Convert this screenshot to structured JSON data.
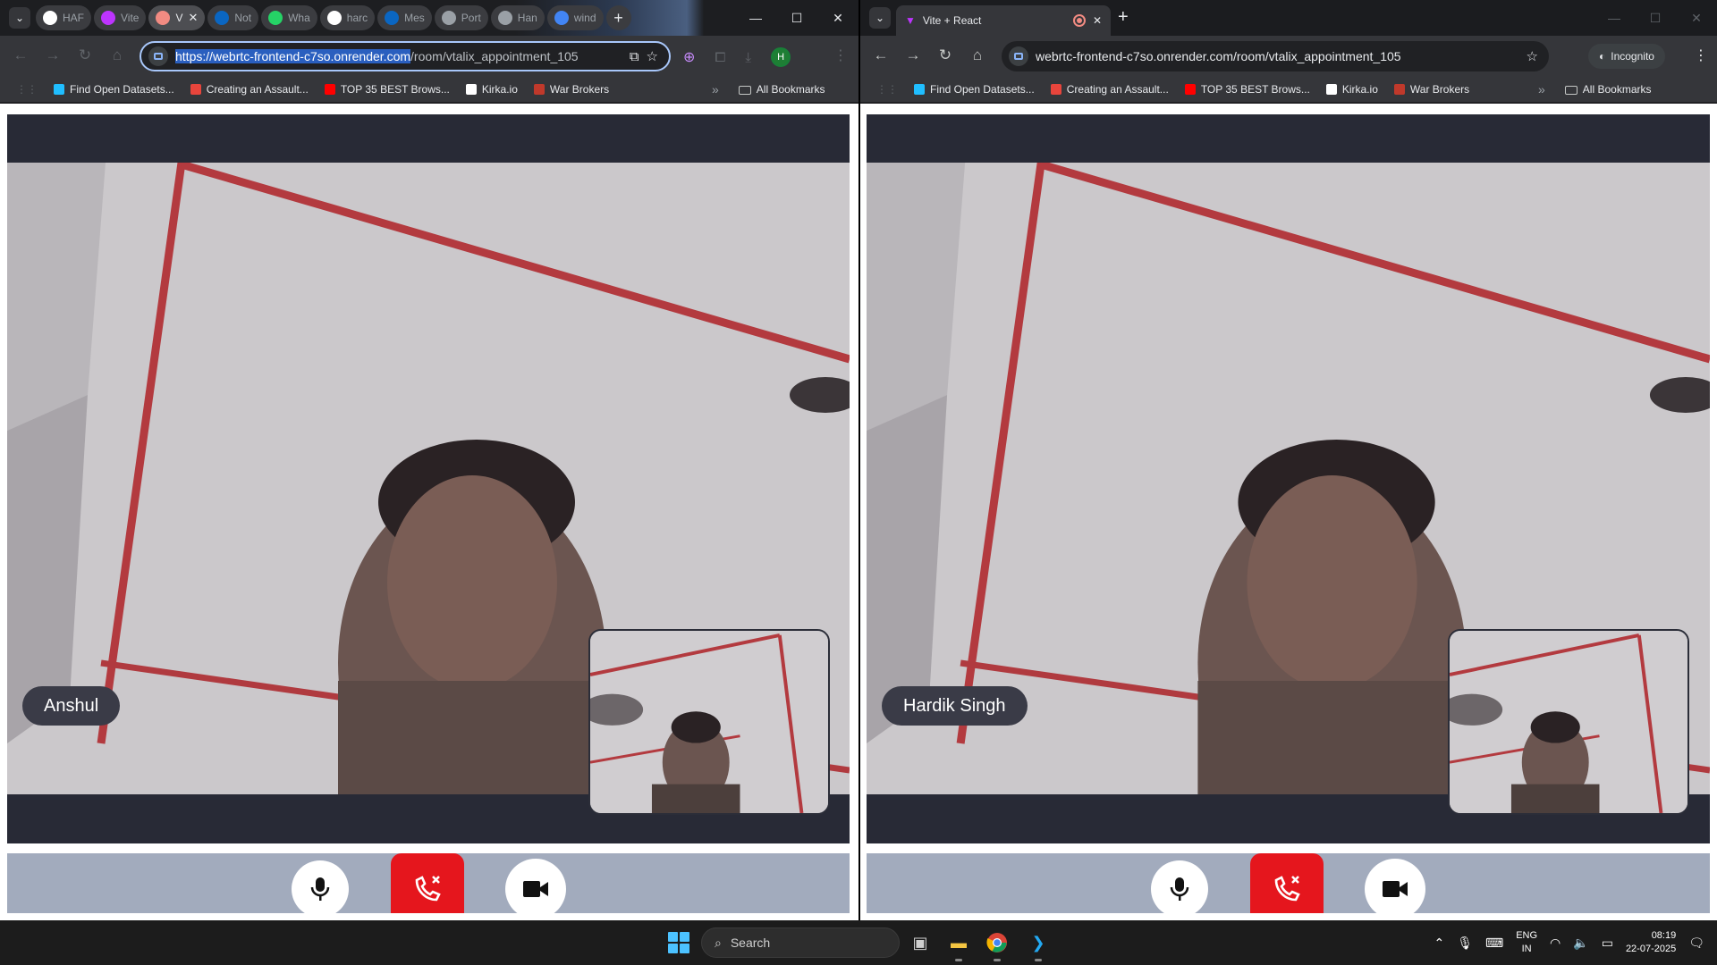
{
  "left_window": {
    "tabs": [
      {
        "label": "HAF",
        "icon": "chatgpt-icon",
        "color": "#ffffff"
      },
      {
        "label": "Vite",
        "icon": "vite-icon",
        "color": "#bd34fe"
      },
      {
        "label": "V",
        "icon": "recording-icon",
        "color": "#f28b82",
        "active": true
      },
      {
        "label": "Not",
        "icon": "linkedin-icon",
        "color": "#0a66c2"
      },
      {
        "label": "Wha",
        "icon": "whatsapp-icon",
        "color": "#25d366"
      },
      {
        "label": "harc",
        "icon": "github-icon",
        "color": "#ffffff"
      },
      {
        "label": "Mes",
        "icon": "linkedin-icon",
        "color": "#0a66c2"
      },
      {
        "label": "Port",
        "icon": "globe-icon",
        "color": "#9aa0a6"
      },
      {
        "label": "Han",
        "icon": "globe-icon",
        "color": "#9aa0a6"
      },
      {
        "label": "wind",
        "icon": "google-icon",
        "color": "#4285f4"
      }
    ],
    "url_selected": "https://webrtc-frontend-c7so.onrender.com",
    "url_rest": "/room/vtalix_appointment_105",
    "profile_initial": "H",
    "participant_name": "Anshul"
  },
  "right_window": {
    "tab_title": "Vite + React",
    "url": "webrtc-frontend-c7so.onrender.com/room/vtalix_appointment_105",
    "incognito_label": "Incognito",
    "participant_name": "Hardik Singh"
  },
  "bookmarks": [
    {
      "label": "Find Open Datasets...",
      "icon": "kaggle-icon",
      "color": "#20beff"
    },
    {
      "label": "Creating an Assault...",
      "icon": "recording-icon",
      "color": "#e8453c"
    },
    {
      "label": "TOP 35 BEST Brows...",
      "icon": "youtube-icon",
      "color": "#ff0000"
    },
    {
      "label": "Kirka.io",
      "icon": "kirka-icon",
      "color": "#ffffff"
    },
    {
      "label": "War Brokers",
      "icon": "warbrokers-icon",
      "color": "#c0392b"
    }
  ],
  "all_bookmarks": "All Bookmarks",
  "overflow": "»",
  "controls": {
    "mic": "microphone-icon",
    "end": "end-call-icon",
    "cam": "camera-icon",
    "end_color": "#e5161d",
    "bar_color": "#a2abbd"
  },
  "taskbar": {
    "search_label": "Search",
    "lang_line1": "ENG",
    "lang_line2": "IN",
    "time": "08:19",
    "date": "22-07-2025"
  }
}
